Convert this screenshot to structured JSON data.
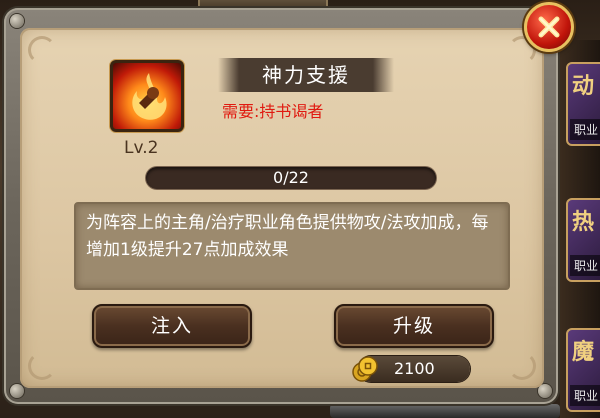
{
  "background": {
    "top_tab_label": "",
    "side_cards": [
      {
        "glyph": "动",
        "tag": "职业"
      },
      {
        "glyph": "热",
        "tag": "职业"
      },
      {
        "glyph": "魔",
        "tag": "职业"
      }
    ],
    "bottom_text": "",
    "accent_color": "#e8c060"
  },
  "skill": {
    "icon": "fire-fist-icon",
    "level": "Lv.2",
    "title": "神力支援",
    "requirement": "需要:持书谒者",
    "progress_text": "0/22",
    "progress_fraction": 0,
    "description": "为阵容上的主角/治疗职业角色提供物攻/法攻加成，每增加1级提升27点加成效果"
  },
  "buttons": {
    "inject_label": "注入",
    "upgrade_label": "升级"
  },
  "cost": {
    "icon": "gold-coins-icon",
    "amount": "2100"
  },
  "close": {
    "icon": "close-icon"
  },
  "colors": {
    "requirement": "#e01a10",
    "parchment": "#dcc6a2",
    "close_button": "#c0140a"
  }
}
